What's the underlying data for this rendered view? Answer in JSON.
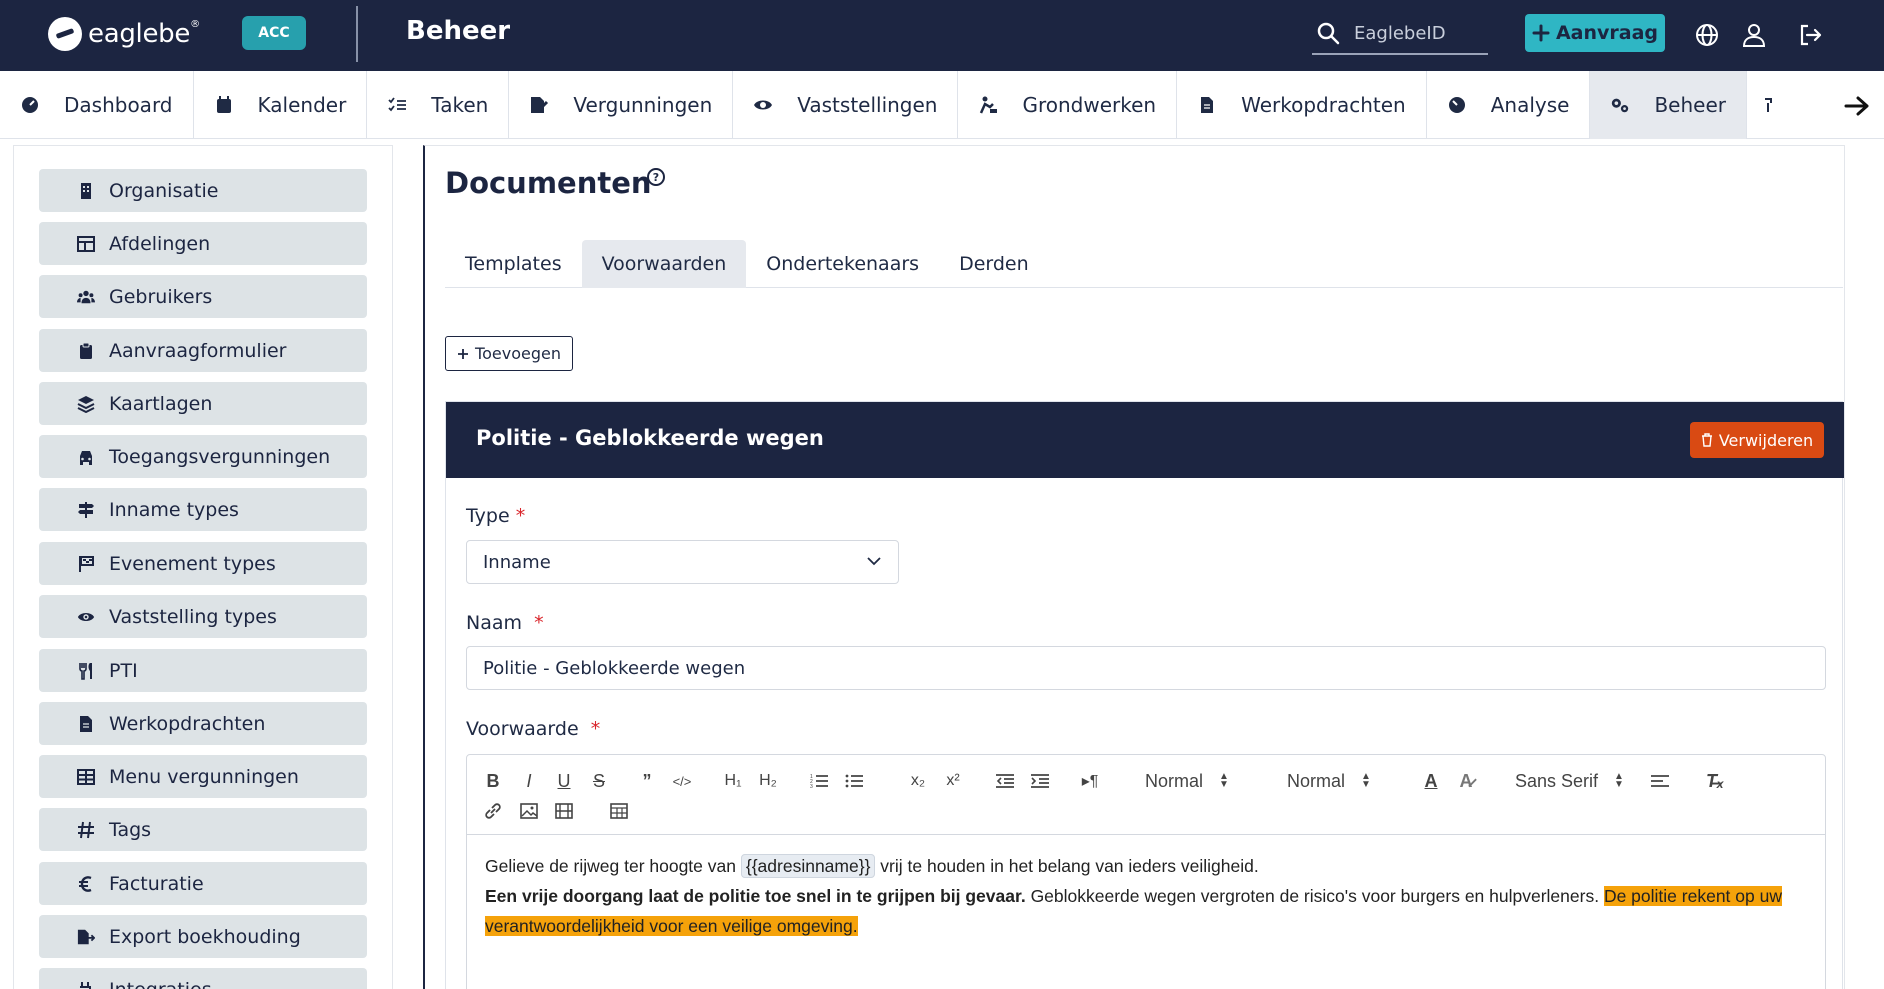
{
  "app": {
    "logo_text": "eaglebe",
    "logo_sup": "®",
    "env_badge": "ACC",
    "title": "Beheer"
  },
  "search": {
    "placeholder": "EaglebeID"
  },
  "header_button": {
    "label": "Aanvraag",
    "icon": "plus-icon"
  },
  "header_icons": [
    "globe-icon",
    "user-icon",
    "logout-icon"
  ],
  "nav": {
    "items": [
      {
        "label": "Dashboard",
        "icon": "dashboard-icon"
      },
      {
        "label": "Kalender",
        "icon": "calendar-icon"
      },
      {
        "label": "Taken",
        "icon": "tasks-icon"
      },
      {
        "label": "Vergunningen",
        "icon": "permit-icon"
      },
      {
        "label": "Vaststellingen",
        "icon": "eye-icon"
      },
      {
        "label": "Grondwerken",
        "icon": "digging-icon"
      },
      {
        "label": "Werkopdrachten",
        "icon": "document-icon"
      },
      {
        "label": "Analyse",
        "icon": "analysis-icon"
      },
      {
        "label": "Beheer",
        "icon": "gears-icon",
        "active": true
      }
    ]
  },
  "sidebar": {
    "items": [
      {
        "label": "Organisatie",
        "icon": "building-icon"
      },
      {
        "label": "Afdelingen",
        "icon": "table-icon"
      },
      {
        "label": "Gebruikers",
        "icon": "users-icon"
      },
      {
        "label": "Aanvraagformulier",
        "icon": "clipboard-icon"
      },
      {
        "label": "Kaartlagen",
        "icon": "layers-icon"
      },
      {
        "label": "Toegangsvergunningen",
        "icon": "car-icon"
      },
      {
        "label": "Inname types",
        "icon": "signpost-icon"
      },
      {
        "label": "Evenement types",
        "icon": "flag-icon"
      },
      {
        "label": "Vaststelling types",
        "icon": "eye-icon"
      },
      {
        "label": "PTI",
        "icon": "utensils-icon"
      },
      {
        "label": "Werkopdrachten",
        "icon": "document-icon"
      },
      {
        "label": "Menu vergunningen",
        "icon": "grid-icon"
      },
      {
        "label": "Tags",
        "icon": "hashtag-icon"
      },
      {
        "label": "Facturatie",
        "icon": "euro-icon"
      },
      {
        "label": "Export boekhouding",
        "icon": "file-export-icon"
      },
      {
        "label": "Integraties",
        "icon": "plug-icon"
      }
    ]
  },
  "main": {
    "title": "Documenten",
    "tabs": [
      "Templates",
      "Voorwaarden",
      "Ondertekenaars",
      "Derden"
    ],
    "active_tab": "Voorwaarden",
    "add_button": "Toevoegen"
  },
  "card": {
    "title": "Politie - Geblokkeerde wegen",
    "delete_button": "Verwijderen",
    "type_label": "Type",
    "type_value": "Inname",
    "naam_label": "Naam",
    "naam_value": "Politie - Geblokkeerde wegen",
    "voorwaarde_label": "Voorwaarde",
    "required_mark": "*"
  },
  "editor": {
    "toolbar": {
      "header_size": "Normal",
      "font_size": "Normal",
      "font_family": "Sans Serif"
    },
    "line1_prefix": "Gelieve de rijweg ter hoogte van",
    "placeholder": "{{adresinname}}",
    "line1_suffix": "vrij te houden in het belang van ieders veiligheid.",
    "bold_sentence": "Een vrije doorgang laat de politie toe snel in te grijpen bij gevaar.",
    "normal_sentence": "Geblokkeerde wegen vergroten de risico's voor burgers en hulpverleners.",
    "highlight_sentence": "De politie rekent op uw verantwoordelijkheid voor een veilige omgeving."
  },
  "colors": {
    "navy": "#1c2541",
    "teal": "#27a0ad",
    "accent": "#2fb6c4",
    "danger": "#d94a13",
    "highlight": "#f5a20a",
    "sidebar_item": "#dde3e6"
  }
}
